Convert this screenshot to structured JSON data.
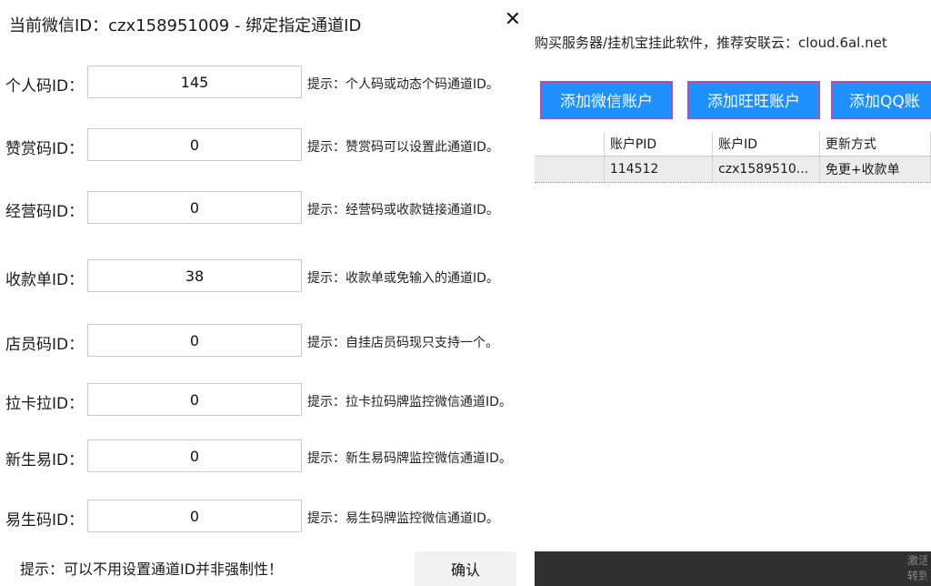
{
  "dialog": {
    "title": "当前微信ID：czx158951009 - 绑定指定通道ID",
    "close_glyph": "✕",
    "rows": [
      {
        "label": "个人码ID：",
        "value": "145",
        "hint": "提示：个人码或动态个码通道ID。"
      },
      {
        "label": "赞赏码ID：",
        "value": "0",
        "hint": "提示：赞赏码可以设置此通道ID。"
      },
      {
        "label": "经营码ID：",
        "value": "0",
        "hint": "提示：经营码或收款链接通道ID。"
      },
      {
        "label": "收款单ID：",
        "value": "38",
        "hint": "提示：收款单或免输入的通道ID。"
      },
      {
        "label": "店员码ID：",
        "value": "0",
        "hint": "提示：自挂店员码现只支持一个。"
      },
      {
        "label": "拉卡拉ID：",
        "value": "0",
        "hint": "提示：拉卡拉码牌监控微信通道ID。"
      },
      {
        "label": "新生易ID：",
        "value": "0",
        "hint": "提示：新生易码牌监控微信通道ID。"
      },
      {
        "label": "易生码ID：",
        "value": "0",
        "hint": "提示：易生码牌监控微信通道ID。"
      }
    ],
    "bottom_hint": "提示：可以不用设置通道ID并非强制性！",
    "confirm_label": "确认"
  },
  "background_app": {
    "notice": "购买服务器/挂机宝挂此软件，推荐安联云：cloud.6al.net",
    "buttons": [
      "添加微信账户",
      "添加旺旺账户",
      "添加QQ账"
    ],
    "table": {
      "headers": [
        "",
        "账户PID",
        "账户ID",
        "更新方式"
      ],
      "rows": [
        [
          "",
          "114512",
          "czx1589510...",
          "免更+收款单"
        ]
      ]
    },
    "taskbar_text": [
      "激活",
      "转到"
    ]
  },
  "colors": {
    "accent_button": "#1e90ff",
    "button_border": "#b14fb8",
    "taskbar": "#303030"
  }
}
